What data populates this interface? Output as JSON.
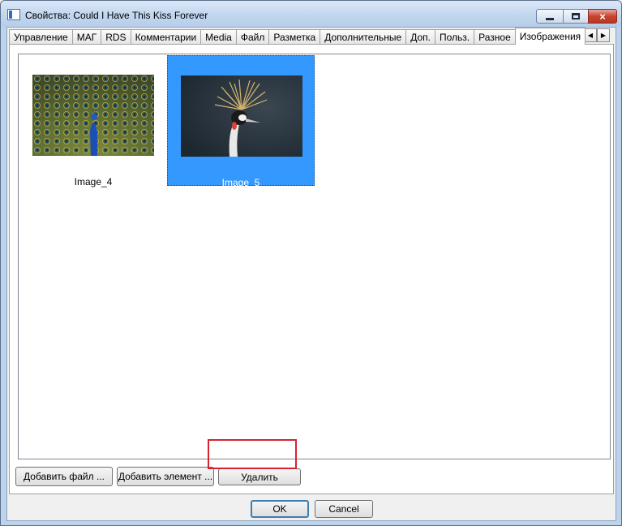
{
  "window": {
    "title": "Свойства: Could I Have This Kiss Forever",
    "buttons": {
      "minimize": "minimize-icon",
      "maximize": "maximize-icon",
      "close": "×"
    }
  },
  "tabs": [
    {
      "label": "Управление"
    },
    {
      "label": "МАГ"
    },
    {
      "label": "RDS"
    },
    {
      "label": "Комментарии"
    },
    {
      "label": "Media"
    },
    {
      "label": "Файл"
    },
    {
      "label": "Разметка"
    },
    {
      "label": "Дополнительные"
    },
    {
      "label": "Доп."
    },
    {
      "label": "Польз."
    },
    {
      "label": "Разное"
    },
    {
      "label": "Изображения",
      "active": true
    }
  ],
  "tab_scroll": {
    "left": "◀",
    "right": "▶"
  },
  "images": [
    {
      "caption": "Image_4",
      "selected": false,
      "icon": "peacock-image"
    },
    {
      "caption": "Image_5",
      "selected": true,
      "icon": "crowned-crane-image"
    }
  ],
  "actions": {
    "add_file": "Добавить файл ...",
    "add_element": "Добавить элемент ...",
    "delete": "Удалить"
  },
  "dialog": {
    "ok": "OK",
    "cancel": "Cancel"
  },
  "colors": {
    "selection": "#3399ff",
    "highlight": "#d6242e"
  }
}
